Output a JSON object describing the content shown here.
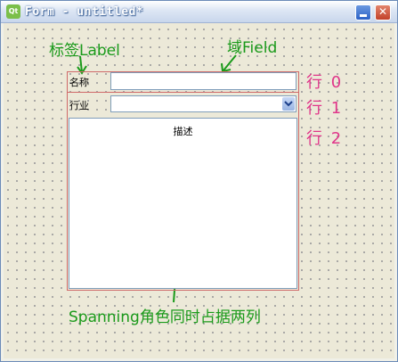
{
  "window": {
    "title": "Form - untitled*",
    "app_icon_text": "Qt"
  },
  "annotations": {
    "label_note": "标签Label",
    "field_note": "域Field",
    "spanning_note": "Spanning角色同时占据两列",
    "rows": [
      "行 0",
      "行 1",
      "行 2"
    ],
    "colors": {
      "green": "#1a9a1a",
      "pink": "#e0368a",
      "frame": "#cf6a6a"
    }
  },
  "form": {
    "name_label": "名称",
    "name_value": "",
    "industry_label": "行业",
    "industry_value": "",
    "description_caption": "描述"
  },
  "icons": {
    "minimize": "minimize-icon",
    "close": "close-icon",
    "dropdown": "chevron-down-icon"
  }
}
